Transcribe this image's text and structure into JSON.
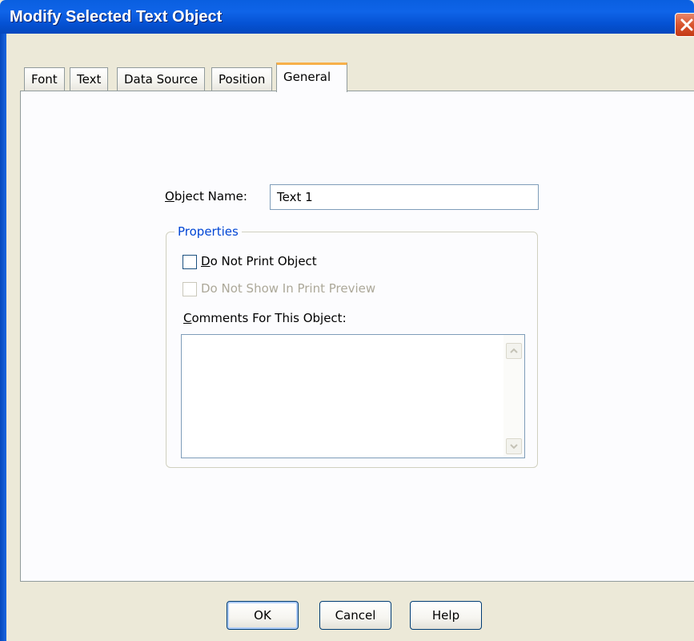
{
  "window": {
    "title": "Modify Selected Text Object"
  },
  "tabs": [
    {
      "label": "Font"
    },
    {
      "label": "Text"
    },
    {
      "label": "Data Source"
    },
    {
      "label": "Position"
    },
    {
      "label": "General"
    }
  ],
  "general": {
    "object_name_label": "Object Name:",
    "object_name_value": "Text 1",
    "properties_title": "Properties",
    "do_not_print_label": "Do Not Print Object",
    "do_not_show_preview_label": "Do Not Show In Print Preview",
    "comments_label": "Comments For This Object:",
    "comments_value": ""
  },
  "buttons": {
    "ok": "OK",
    "cancel": "Cancel",
    "help": "Help"
  },
  "icons": {
    "close": "close-icon",
    "scroll_up": "scroll-up-arrow-icon",
    "scroll_down": "scroll-down-arrow-icon"
  },
  "colors": {
    "titlebar": "#0552d4",
    "active_tab_accent": "#f7b04a",
    "group_title": "#0046d5",
    "close_button": "#d8542e"
  }
}
